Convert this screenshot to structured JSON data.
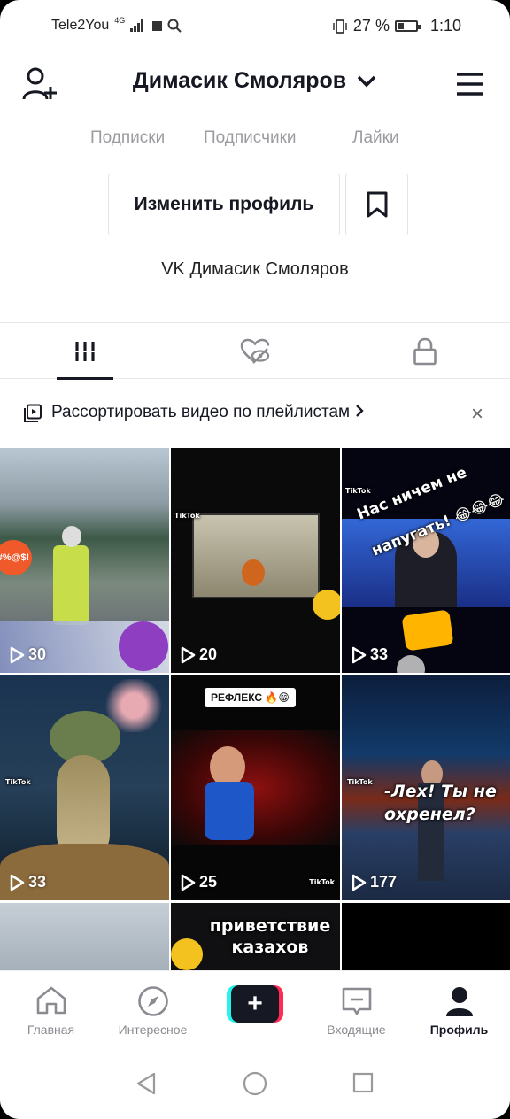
{
  "status_bar": {
    "carrier": "Tele2You",
    "network": "4G",
    "battery": "27 %",
    "time": "1:10"
  },
  "header": {
    "username": "Димасик Смоляров"
  },
  "stats": {
    "following": "Подписки",
    "followers": "Подписчики",
    "likes": "Лайки"
  },
  "profile": {
    "edit_label": "Изменить профиль",
    "bio": "VK Димасик Смоляров"
  },
  "playlist_banner": {
    "text": "Рассортировать видео по плейлистам",
    "close": "×"
  },
  "videos": [
    {
      "views": "30",
      "caption": "",
      "theme": "road"
    },
    {
      "views": "20",
      "caption": "",
      "theme": "cartoon"
    },
    {
      "views": "33",
      "caption": "Нас ничем не напугать! 😂😂😂",
      "theme": "news"
    },
    {
      "views": "33",
      "caption": "",
      "theme": "turtle"
    },
    {
      "views": "25",
      "caption": "РЕФЛЕКС 🔥😁",
      "theme": "stage"
    },
    {
      "views": "177",
      "caption": "-Лех! Ты не охренел?",
      "theme": "show"
    },
    {
      "views": "",
      "caption": "",
      "theme": "sky"
    },
    {
      "views": "",
      "caption": "приветствие казахов",
      "theme": "dark"
    },
    {
      "views": "",
      "caption": "",
      "theme": "black"
    }
  ],
  "tiktok_watermark": "TikTok",
  "bottom_nav": [
    {
      "label": "Главная",
      "icon": "home-icon"
    },
    {
      "label": "Интересное",
      "icon": "compass-icon"
    },
    {
      "label": "",
      "icon": "plus-icon"
    },
    {
      "label": "Входящие",
      "icon": "inbox-icon"
    },
    {
      "label": "Профиль",
      "icon": "profile-icon"
    }
  ],
  "colors": {
    "accent_red": "#fe2c55",
    "accent_cyan": "#25f4ee",
    "text_dark": "#161823",
    "text_gray": "#9b9ca1"
  }
}
